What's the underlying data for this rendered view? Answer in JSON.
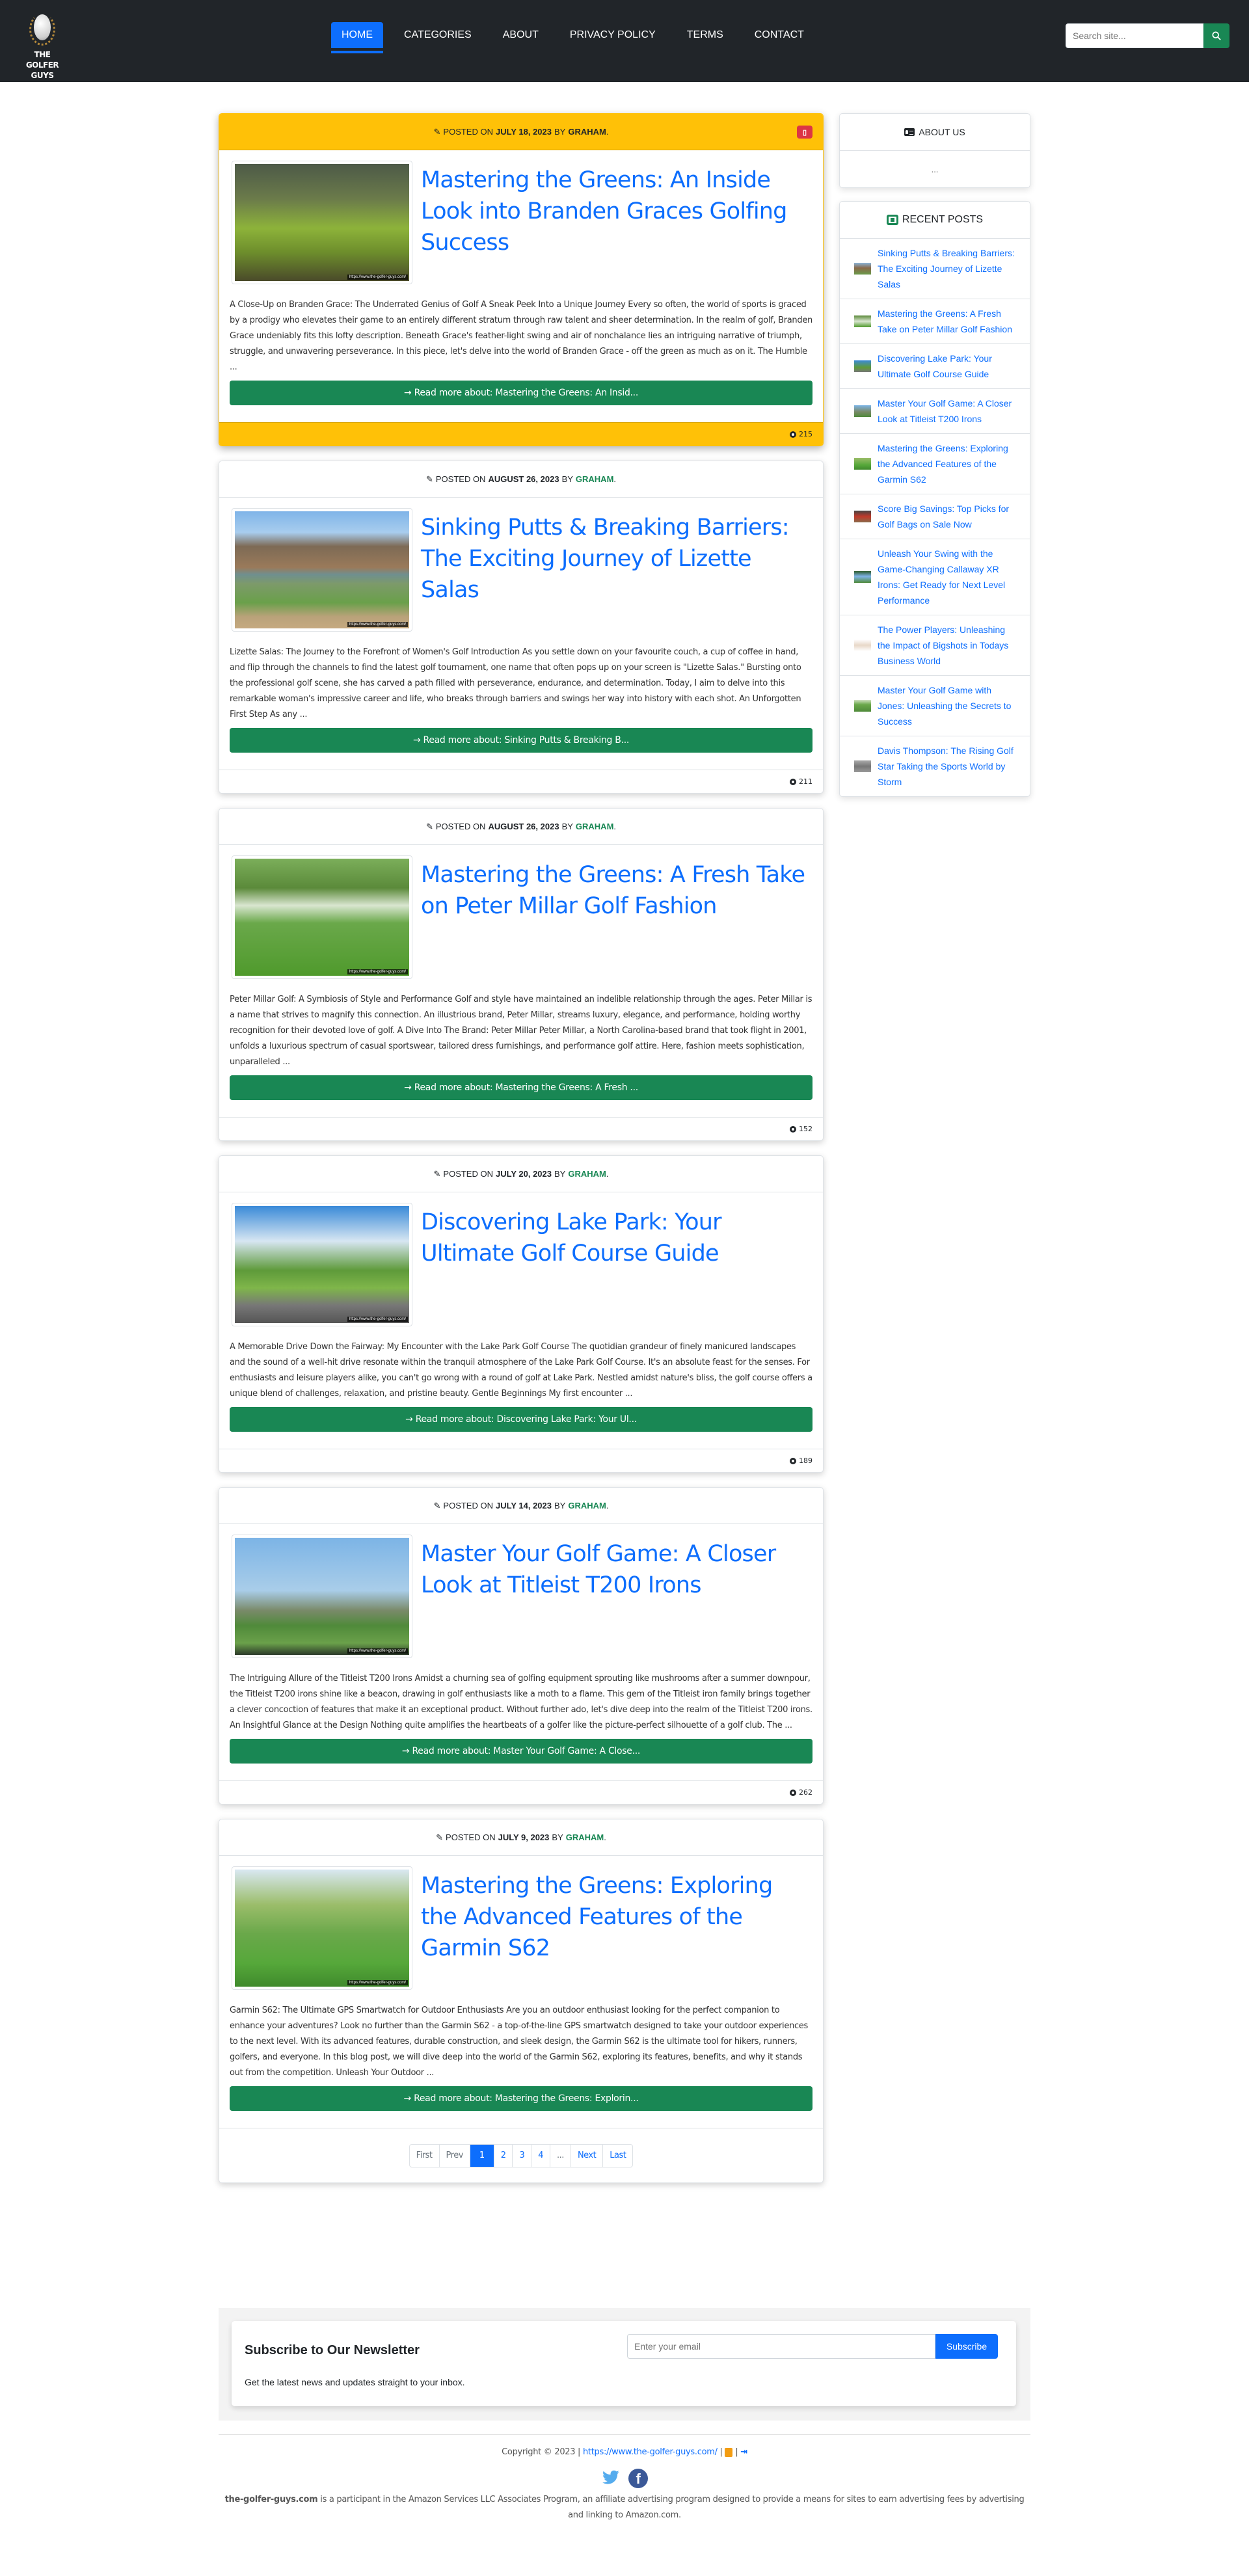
{
  "brand": {
    "name_line1": "THE GOLFER",
    "name_line2": "GUYS"
  },
  "nav": {
    "items": [
      {
        "label": "HOME",
        "active": true
      },
      {
        "label": "CATEGORIES",
        "active": false
      },
      {
        "label": "ABOUT",
        "active": false
      },
      {
        "label": "PRIVACY POLICY",
        "active": false
      },
      {
        "label": "TERMS",
        "active": false
      },
      {
        "label": "CONTACT",
        "active": false
      }
    ],
    "search_placeholder": "Search site..."
  },
  "posts": [
    {
      "featured": true,
      "posted_prefix": "POSTED ON",
      "date": "JULY 18, 2023",
      "by": "BY",
      "author": "GRAHAM",
      "title": "Mastering the Greens: An Inside Look into Branden Graces Golfing Success",
      "excerpt": "A Close-Up on Branden Grace: The Underrated Genius of Golf A Sneak Peek Into a Unique Journey Every so often, the world of sports is graced by a prodigy who elevates their game to an entirely different stratum through raw talent and sheer determination. In the realm of golf, Branden Grace undeniably fits this lofty description. Beneath Grace's feather-light swing and air of nonchalance lies an intriguing narrative of triumph, struggle, and unwavering perseverance. In this piece, let's delve into the world of Branden Grace - off the green as much as on it. The Humble ...",
      "read_more": "→ Read more about: Mastering the Greens: An Insid...",
      "views": "215",
      "image_watermark": "https://www.the-golfer-guys.com/"
    },
    {
      "featured": false,
      "posted_prefix": "POSTED ON",
      "date": "AUGUST 26, 2023",
      "by": "BY",
      "author": "GRAHAM",
      "title": "Sinking Putts & Breaking Barriers: The Exciting Journey of Lizette Salas",
      "excerpt": "Lizette Salas: The Journey to the Forefront of Women's Golf Introduction As you settle down on your favourite couch, a cup of coffee in hand, and flip through the channels to find the latest golf tournament, one name that often pops up on your screen is \"Lizette Salas.\" Bursting onto the professional golf scene, she has carved a path filled with perseverance, endurance, and determination. Today, I aim to delve into this remarkable woman's impressive career and life, who breaks through barriers and swings her way into history with each shot. An Unforgotten First Step As any ...",
      "read_more": "→ Read more about: Sinking Putts & Breaking B...",
      "views": "211",
      "image_watermark": "https://www.the-golfer-guys.com/"
    },
    {
      "featured": false,
      "posted_prefix": "POSTED ON",
      "date": "AUGUST 26, 2023",
      "by": "BY",
      "author": "GRAHAM",
      "title": "Mastering the Greens: A Fresh Take on Peter Millar Golf Fashion",
      "excerpt": "Peter Millar Golf: A Symbiosis of Style and Performance Golf and style have maintained an indelible relationship through the ages. Peter Millar is a name that strives to magnify this connection. An illustrious brand, Peter Millar, streams luxury, elegance, and performance, holding worthy recognition for their devoted love of golf. A Dive Into The Brand: Peter Millar Peter Millar, a North Carolina-based brand that took flight in 2001, unfolds a luxurious spectrum of casual sportswear, tailored dress furnishings, and performance golf attire. Here, fashion meets sophistication, unparalleled ...",
      "read_more": "→ Read more about: Mastering the Greens: A Fresh ...",
      "views": "152",
      "image_watermark": "https://www.the-golfer-guys.com/"
    },
    {
      "featured": false,
      "posted_prefix": "POSTED ON",
      "date": "JULY 20, 2023",
      "by": "BY",
      "author": "GRAHAM",
      "title": "Discovering Lake Park: Your Ultimate Golf Course Guide",
      "excerpt": "A Memorable Drive Down the Fairway: My Encounter with the Lake Park Golf Course The quotidian grandeur of finely manicured landscapes and the sound of a well-hit drive resonate within the tranquil atmosphere of the Lake Park Golf Course. It's an absolute feast for the senses. For enthusiasts and leisure players alike, you can't go wrong with a round of golf at Lake Park. Nestled amidst nature's bliss, the golf course offers a unique blend of challenges, relaxation, and pristine beauty. Gentle Beginnings My first encounter ...",
      "read_more": "→ Read more about: Discovering Lake Park: Your Ul...",
      "views": "189",
      "image_watermark": "https://www.the-golfer-guys.com/"
    },
    {
      "featured": false,
      "posted_prefix": "POSTED ON",
      "date": "JULY 14, 2023",
      "by": "BY",
      "author": "GRAHAM",
      "title": "Master Your Golf Game: A Closer Look at Titleist T200 Irons",
      "excerpt": "The Intriguing Allure of the Titleist T200 Irons Amidst a churning sea of golfing equipment sprouting like mushrooms after a summer downpour, the Titleist T200 irons shine like a beacon, drawing in golf enthusiasts like a moth to a flame. This gem of the Titleist iron family brings together a clever concoction of features that make it an exceptional product. Without further ado, let's dive deep into the realm of the Titleist T200 irons. An Insightful Glance at the Design Nothing quite amplifies the heartbeats of a golfer like the picture-perfect silhouette of a golf club. The ...",
      "read_more": "→ Read more about: Master Your Golf Game: A Close...",
      "views": "262",
      "image_watermark": "https://www.the-golfer-guys.com/"
    },
    {
      "featured": false,
      "posted_prefix": "POSTED ON",
      "date": "JULY 9, 2023",
      "by": "BY",
      "author": "GRAHAM",
      "title": "Mastering the Greens: Exploring the Advanced Features of the Garmin S62",
      "excerpt": "Garmin S62: The Ultimate GPS Smartwatch for Outdoor Enthusiasts Are you an outdoor enthusiast looking for the perfect companion to enhance your adventures? Look no further than the Garmin S62 - a top-of-the-line GPS smartwatch designed to take your outdoor experiences to the next level. With its advanced features, durable construction, and sleek design, the Garmin S62 is the ultimate tool for hikers, runners, golfers, and everyone. In this blog post, we will dive deep into the world of the Garmin S62, exploring its features, benefits, and why it stands out from the competition. Unleash Your Outdoor ...",
      "read_more": "→ Read more about: Mastering the Greens: Explorin...",
      "views": null,
      "image_watermark": "https://www.the-golfer-guys.com/"
    }
  ],
  "pagination": {
    "items": [
      {
        "label": "First",
        "state": "disabled"
      },
      {
        "label": "Prev",
        "state": "disabled"
      },
      {
        "label": "1",
        "state": "active"
      },
      {
        "label": "2",
        "state": "normal"
      },
      {
        "label": "3",
        "state": "normal"
      },
      {
        "label": "4",
        "state": "normal"
      },
      {
        "label": "...",
        "state": "disabled"
      },
      {
        "label": "Next",
        "state": "normal"
      },
      {
        "label": "Last",
        "state": "normal"
      }
    ]
  },
  "sidebar": {
    "about": {
      "title": "ABOUT US",
      "body": "..."
    },
    "recent": {
      "title": "RECENT POSTS",
      "items": [
        {
          "label": "Sinking Putts & Breaking Barriers: The Exciting Journey of Lizette Salas"
        },
        {
          "label": "Mastering the Greens: A Fresh Take on Peter Millar Golf Fashion"
        },
        {
          "label": "Discovering Lake Park: Your Ultimate Golf Course Guide"
        },
        {
          "label": "Master Your Golf Game: A Closer Look at Titleist T200 Irons"
        },
        {
          "label": "Mastering the Greens: Exploring the Advanced Features of the Garmin S62"
        },
        {
          "label": "Score Big Savings: Top Picks for Golf Bags on Sale Now"
        },
        {
          "label": "Unleash Your Swing with the Game-Changing Callaway XR Irons: Get Ready for Next Level Performance"
        },
        {
          "label": "The Power Players: Unleashing the Impact of Bigshots in Todays Business World"
        },
        {
          "label": "Master Your Golf Game with Jones: Unleashing the Secrets to Success"
        },
        {
          "label": "Davis Thompson: The Rising Golf Star Taking the Sports World by Storm"
        }
      ]
    }
  },
  "newsletter": {
    "title": "Subscribe to Our Newsletter",
    "subtitle": "Get the latest news and updates straight to your inbox.",
    "placeholder": "Enter your email",
    "button": "Subscribe"
  },
  "footer": {
    "copyright": "Copyright © 2023 |",
    "site_link": "https://www.the-golfer-guys.com/",
    "sep": "|",
    "affiliate_site": "the-golfer-guys.com",
    "affiliate_text": " is a participant in the Amazon Services LLC Associates Program, an affiliate advertising program designed to provide a means for sites to earn advertising fees by advertising and linking to Amazon.com."
  },
  "colors": {
    "navbar": "#212529",
    "primary": "#0d6efd",
    "success": "#198754",
    "featured": "#ffc107",
    "pin_badge": "#dc3545"
  }
}
